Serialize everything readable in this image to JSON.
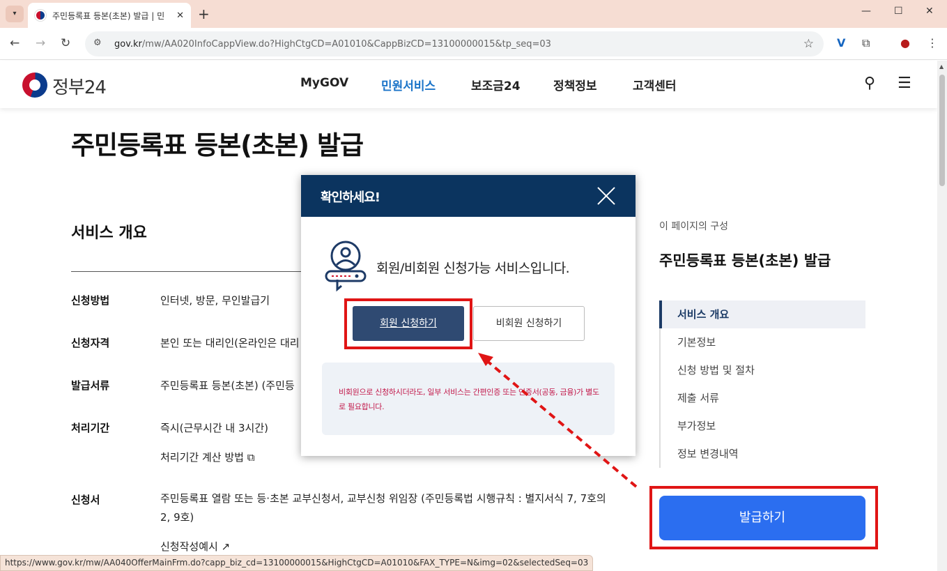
{
  "browser": {
    "tab_title": "주민등록표 등본(초본) 발급 | 민",
    "url_host": "gov.kr",
    "url_path": "/mw/AA020InfoCappView.do?HighCtgCD=A01010&CappBizCD=13100000015&tp_seq=03",
    "status_url": "https://www.gov.kr/mw/AA040OfferMainFrm.do?capp_biz_cd=13100000015&HighCtgCD=A01010&FAX_TYPE=N&img=02&selectedSeq=03"
  },
  "header": {
    "logo_text": "정부24",
    "nav": [
      "MyGOV",
      "민원서비스",
      "보조금24",
      "정책정보",
      "고객센터"
    ],
    "active_nav": "민원서비스"
  },
  "main": {
    "page_title": "주민등록표 등본(초본) 발급",
    "section_title": "서비스 개요",
    "rows": [
      {
        "label": "신청방법",
        "value": "인터넷, 방문, 무인발급기"
      },
      {
        "label": "신청자격",
        "value": "본인 또는 대리인(온라인은 대리"
      },
      {
        "label": "발급서류",
        "value": "주민등록표 등본(초본) (주민등"
      },
      {
        "label": "처리기간",
        "value": "즉시(근무시간 내 3시간)",
        "link": "처리기간 계산 방법"
      },
      {
        "label": "신청서",
        "value": "주민등록표 열람 또는 등·초본 교부신청서, 교부신청 위임장 (주민등록법 시행규칙 : 별지서식 7, 7호의2, 9호)",
        "link": "신청작성예시"
      }
    ]
  },
  "aside": {
    "caption": "이 페이지의 구성",
    "title": "주민등록표 등본(초본) 발급",
    "items": [
      "서비스 개요",
      "기본정보",
      "신청 방법 및 절차",
      "제출 서류",
      "부가정보",
      "정보 변경내역"
    ],
    "issue_button": "발급하기"
  },
  "modal": {
    "title": "확인하세요!",
    "message": "회원/비회원 신청가능 서비스입니다.",
    "member_button": "회원 신청하기",
    "guest_button": "비회원 신청하기",
    "notice": "비회원으로 신청하시더라도, 일부 서비스는 간편인증 또는 인증서(공동, 금융)가 별도로 필요합니다."
  },
  "colors": {
    "modal_header": "#0b345f",
    "member_button": "#2f4a72",
    "issue_button": "#2b6ef0",
    "highlight": "#e01515",
    "notice_text": "#c2184a",
    "active_nav": "#1a73c8"
  }
}
